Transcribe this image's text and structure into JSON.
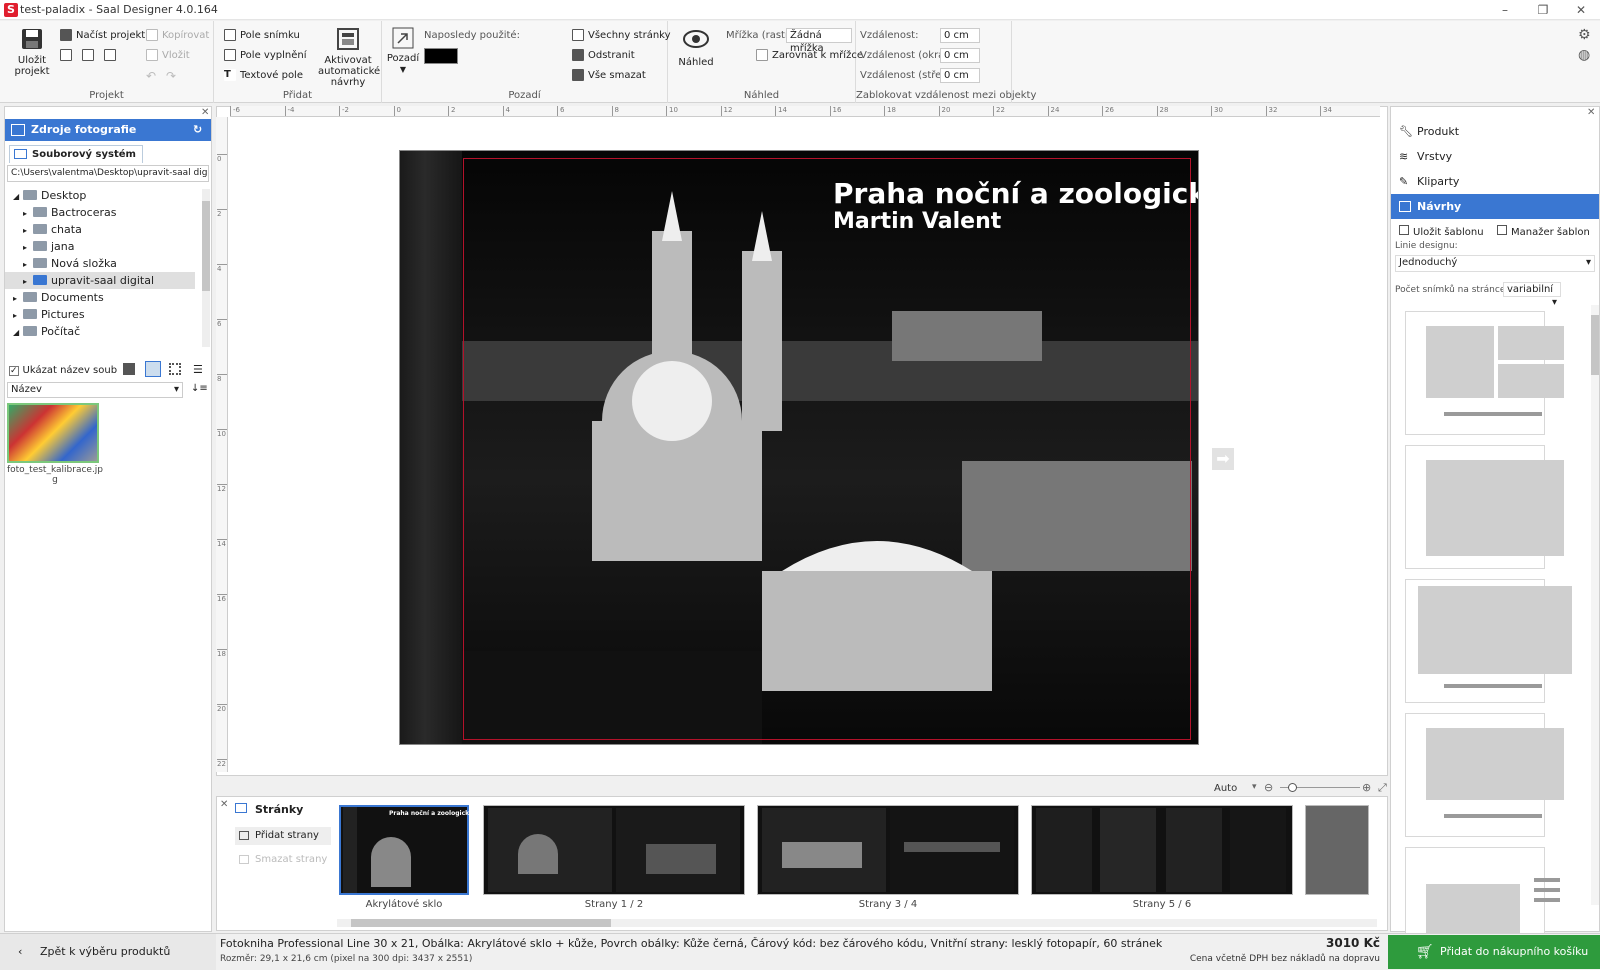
{
  "window": {
    "title": "test-paladix - Saal Designer 4.0.164",
    "app_icon": "S",
    "controls": [
      "–",
      "❐",
      "✕"
    ]
  },
  "ribbon": {
    "projekt": {
      "label": "Projekt",
      "save": "Uložit projekt",
      "load": "Načíst projekt",
      "copy": "Kopírovat",
      "paste": "Vložit"
    },
    "pridat": {
      "label": "Přidat",
      "photo_field": "Pole snímku",
      "fill_field": "Pole vyplnění",
      "text_field": "Textové pole",
      "auto_designs": "Aktivovat automatické návrhy"
    },
    "pozadi": {
      "label": "Pozadí",
      "background": "Pozadí",
      "recent": "Naposledy použité:",
      "recent_color": "#000000",
      "all_pages": "Všechny stránky",
      "remove": "Odstranit",
      "delete_all": "Vše smazat"
    },
    "nahled": {
      "label": "Náhled",
      "preview": "Náhled",
      "grid_label": "Mřížka (rastr):",
      "grid_value": "Žádná mřížka",
      "snap": "Zarovnat k mřížce"
    },
    "distance": {
      "label": "Zablokovat vzdálenost mezi objekty",
      "distance": "Vzdálenost:",
      "distance_value": "0 cm",
      "edge": "Vzdálenost (okraj):",
      "edge_value": "0 cm",
      "center": "Vzdálenost (střed):",
      "center_value": "0 cm"
    }
  },
  "left_panel": {
    "header": "Zdroje fotografie",
    "tab": "Souborový systém",
    "path": "C:\\Users\\valentma\\Desktop\\upravit-saal digital",
    "tree": [
      {
        "label": "Desktop",
        "level": 0,
        "expanded": true
      },
      {
        "label": "Bactroceras",
        "level": 1
      },
      {
        "label": "chata",
        "level": 1
      },
      {
        "label": "jana",
        "level": 1
      },
      {
        "label": "Nová složka",
        "level": 1
      },
      {
        "label": "upravit-saal digital",
        "level": 1,
        "selected": true
      },
      {
        "label": "Documents",
        "level": 0
      },
      {
        "label": "Pictures",
        "level": 0
      },
      {
        "label": "Počítač",
        "level": 0,
        "expanded": true
      }
    ],
    "show_filename": "Ukázat název souboru",
    "sort": "Název",
    "file": {
      "name": "foto_test_kalibrace.jp",
      "name2": "g"
    }
  },
  "cover": {
    "title": "Praha noční a zoologická",
    "author": "Martin Valent"
  },
  "ruler_top": [
    "-6",
    "-4",
    "-2",
    "0",
    "2",
    "4",
    "6",
    "8",
    "10",
    "12",
    "14",
    "16",
    "18",
    "20",
    "22",
    "24",
    "26",
    "28",
    "30",
    "32",
    "34"
  ],
  "ruler_left": [
    "0",
    "2",
    "4",
    "6",
    "8",
    "10",
    "12",
    "14",
    "16",
    "18",
    "20",
    "22"
  ],
  "zoom": {
    "value": "Auto"
  },
  "right_panel": {
    "items": [
      "Produkt",
      "Vrstvy",
      "Kliparty",
      "Návrhy"
    ],
    "active": "Návrhy",
    "save_template": "Uložit šablonu",
    "template_manager": "Manažer šablon",
    "design_line_label": "Linie designu:",
    "design_line": "Jednoduchý",
    "count_label": "Počet snímků na stránce:",
    "count_value": "variabilní"
  },
  "strip": {
    "header": "Stránky",
    "add_pages": "Přidat strany",
    "delete_pages": "Smazat strany",
    "labels": [
      "Akrylátové sklo",
      "Strany 1 / 2",
      "Strany 3 / 4",
      "Strany 5 / 6"
    ],
    "cover_mini_title": "Praha noční a zoologická"
  },
  "status": {
    "back": "Zpět k výběru produktů",
    "product": "Fotokniha Professional Line 30 x 21, Obálka: Akrylátové sklo + kůže, Povrch obálky: Kůže černá, Čárový kód: bez čárového kódu, Vnitřní strany: lesklý fotopapír, 60 stránek",
    "size": "Rozměr: 29,1 x 21,6 cm (pixel na 300 dpi: 3437 x 2551)",
    "price": "3010 Kč",
    "price_note": "Cena včetně DPH bez nákladů na dopravu",
    "cart": "Přidat do nákupního košíku"
  }
}
